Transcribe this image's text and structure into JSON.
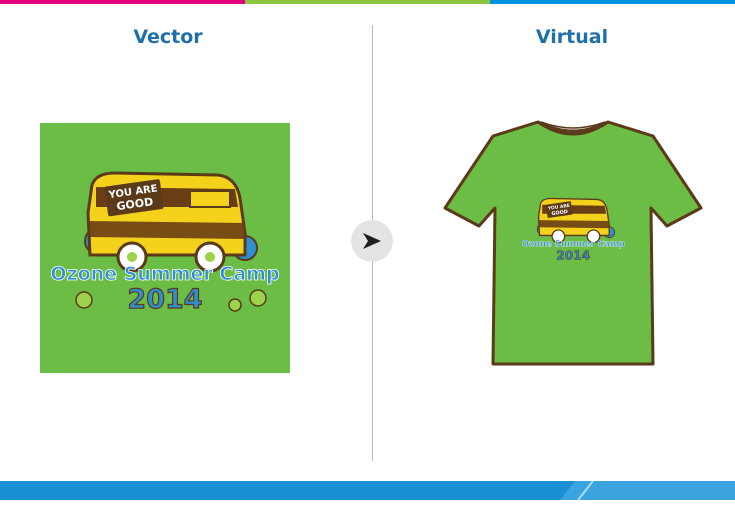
{
  "colors": {
    "top_bar": [
      "#e5007e",
      "#8dc63f",
      "#0093dd"
    ],
    "heading": "#1f6fa8",
    "shirt_green": "#6cbd45",
    "outline_brown": "#5b3a1a",
    "van_yellow": "#f4d21c",
    "text_blue": "#2f8fd4",
    "bottom_bar": "#1a8fd3"
  },
  "left": {
    "heading": "Vector"
  },
  "right": {
    "heading": "Virtual"
  },
  "design": {
    "banner_line1": "YOU ARE",
    "banner_line2": "GOOD",
    "camp_name": "Ozone Summer Camp",
    "year": "2014"
  }
}
